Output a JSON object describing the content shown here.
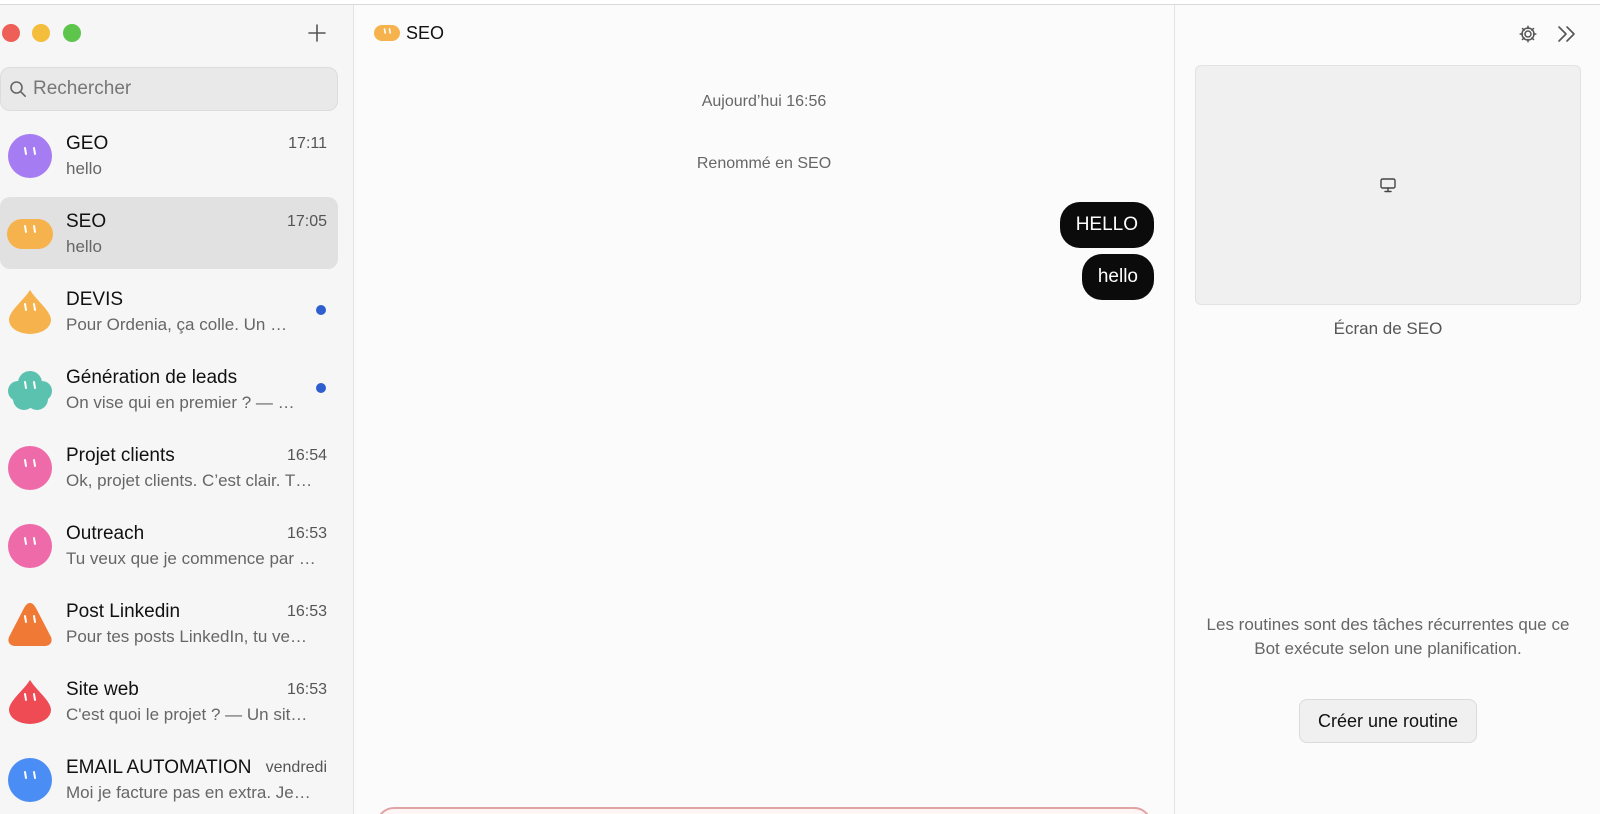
{
  "sidebar": {
    "search_placeholder": "Rechercher",
    "conversations": [
      {
        "name": "GEO",
        "time": "17:11",
        "preview": "hello",
        "color": "#a67cf2",
        "shape": "circle",
        "unread": false,
        "active": false
      },
      {
        "name": "SEO",
        "time": "17:05",
        "preview": "hello",
        "color": "#f6b24d",
        "shape": "pill",
        "unread": false,
        "active": true
      },
      {
        "name": "DEVIS",
        "time": "",
        "preview": "Pour Ordenia, ça colle. Un …",
        "color": "#f6b24d",
        "shape": "drop",
        "unread": true,
        "active": false
      },
      {
        "name": "Génération de leads",
        "time": "",
        "preview": "On vise qui en premier ? — …",
        "color": "#5bc2b0",
        "shape": "cloud",
        "unread": true,
        "active": false
      },
      {
        "name": "Projet clients",
        "time": "16:54",
        "preview": "Ok, projet clients. C’est clair. T…",
        "color": "#ef6aa9",
        "shape": "circle",
        "unread": false,
        "active": false
      },
      {
        "name": "Outreach",
        "time": "16:53",
        "preview": "Tu veux que je commence par …",
        "color": "#ef6aa9",
        "shape": "circle",
        "unread": false,
        "active": false
      },
      {
        "name": "Post Linkedin",
        "time": "16:53",
        "preview": "Pour tes posts LinkedIn, tu ve…",
        "color": "#f07a35",
        "shape": "triangle",
        "unread": false,
        "active": false
      },
      {
        "name": "Site web",
        "time": "16:53",
        "preview": "C'est quoi le projet ? — Un sit…",
        "color": "#ee4b55",
        "shape": "drop",
        "unread": false,
        "active": false
      },
      {
        "name": "EMAIL AUTOMATION",
        "time": "vendredi",
        "preview": "Moi je facture pas en extra. Je…",
        "color": "#4a8ef5",
        "shape": "circle",
        "unread": false,
        "active": false
      }
    ]
  },
  "chat": {
    "title": "SEO",
    "avatar_color": "#f6b24d",
    "date_divider": "Aujourd’hui 16:56",
    "system_event": "Renommé en SEO",
    "messages": [
      {
        "text": "HELLO",
        "from": "user"
      },
      {
        "text": "hello",
        "from": "user"
      }
    ]
  },
  "panel": {
    "screen_caption": "Écran de SEO",
    "routines_text": "Les routines sont des tâches récurrentes que ce Bot exécute selon une planification.",
    "create_routine_label": "Créer une routine"
  },
  "colors": {
    "unread_dot": "#2f5fcf",
    "bubble_bg": "#0b0b0b",
    "active_row": "#e1e1e1"
  }
}
